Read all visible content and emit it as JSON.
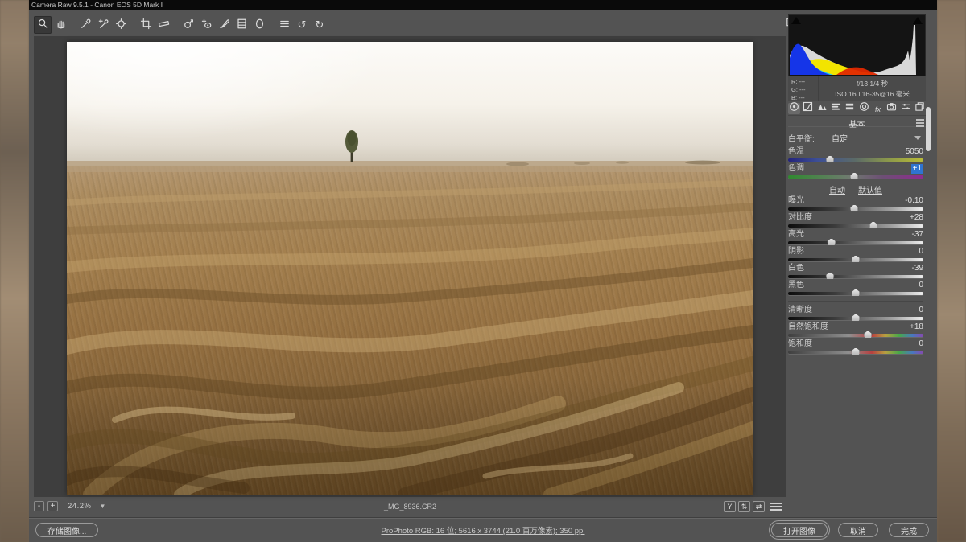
{
  "window": {
    "title": "Camera Raw 9.5.1 -  Canon EOS 5D Mark Ⅱ"
  },
  "toolbar": {
    "tools": [
      {
        "name": "zoom-tool",
        "icon": "magnifier-icon",
        "selected": true,
        "gap": false
      },
      {
        "name": "hand-tool",
        "icon": "hand-icon",
        "selected": false,
        "gap": false
      },
      {
        "name": "white-balance-tool",
        "icon": "eyedropper-icon",
        "selected": false,
        "gap": true
      },
      {
        "name": "color-sampler-tool",
        "icon": "eyedropper-plus-icon",
        "selected": false,
        "gap": false
      },
      {
        "name": "targeted-adjustment-tool",
        "icon": "target-icon",
        "selected": false,
        "gap": false
      },
      {
        "name": "crop-tool",
        "icon": "crop-icon",
        "selected": false,
        "gap": true
      },
      {
        "name": "straighten-tool",
        "icon": "straighten-icon",
        "selected": false,
        "gap": false
      },
      {
        "name": "spot-removal-tool",
        "icon": "heal-brush-icon",
        "selected": false,
        "gap": true
      },
      {
        "name": "red-eye-tool",
        "icon": "red-eye-icon",
        "selected": false,
        "gap": false
      },
      {
        "name": "adjustment-brush-tool",
        "icon": "brush-icon",
        "selected": false,
        "gap": false
      },
      {
        "name": "graduated-filter-tool",
        "icon": "graduated-filter-icon",
        "selected": false,
        "gap": false
      },
      {
        "name": "radial-filter-tool",
        "icon": "radial-filter-icon",
        "selected": false,
        "gap": false
      },
      {
        "name": "preferences-button",
        "icon": "menu-lines-icon",
        "selected": false,
        "gap": true
      },
      {
        "name": "rotate-left-button",
        "icon": "rotate-left-icon",
        "selected": false,
        "gap": false
      },
      {
        "name": "rotate-right-button",
        "icon": "rotate-right-icon",
        "selected": false,
        "gap": false
      }
    ]
  },
  "exif": {
    "r": "R: ---",
    "g": "G: ---",
    "b": "B: ---",
    "line1": "f/13  1/4 秒",
    "line2": "ISO 160  16-35@16 毫米"
  },
  "panel": {
    "tabs": [
      {
        "name": "tab-basic",
        "icon": "aperture-icon",
        "selected": true
      },
      {
        "name": "tab-tone-curve",
        "icon": "curve-icon",
        "selected": false
      },
      {
        "name": "tab-detail",
        "icon": "detail-icon",
        "selected": false
      },
      {
        "name": "tab-hsl-grayscale",
        "icon": "hsl-icon",
        "selected": false
      },
      {
        "name": "tab-split-toning",
        "icon": "split-toning-icon",
        "selected": false
      },
      {
        "name": "tab-lens-corrections",
        "icon": "lens-icon",
        "selected": false
      },
      {
        "name": "tab-effects",
        "icon": "fx-icon",
        "selected": false
      },
      {
        "name": "tab-camera-calibration",
        "icon": "camera-icon",
        "selected": false
      },
      {
        "name": "tab-presets",
        "icon": "presets-icon",
        "selected": false
      },
      {
        "name": "tab-snapshots",
        "icon": "snapshots-icon",
        "selected": false
      }
    ],
    "title": "基本"
  },
  "controls": {
    "white_balance_label": "白平衡:",
    "white_balance_value": "自定",
    "wb_sliders": [
      {
        "id": "temperature",
        "label": "色温",
        "value": "5050",
        "pos": 31,
        "track": "temp",
        "highlight": false
      },
      {
        "id": "tint",
        "label": "色调",
        "value": "+1",
        "pos": 49,
        "track": "tint",
        "highlight": true
      }
    ],
    "auto_label": "自动",
    "default_label": "默认值",
    "tone_sliders": [
      {
        "id": "exposure",
        "label": "曝光",
        "value": "-0.10",
        "pos": 49,
        "track": "tone",
        "highlight": false
      },
      {
        "id": "contrast",
        "label": "对比度",
        "value": "+28",
        "pos": 63,
        "track": "tone",
        "highlight": false
      },
      {
        "id": "highlights",
        "label": "高光",
        "value": "-37",
        "pos": 32,
        "track": "tone",
        "highlight": false
      },
      {
        "id": "shadows",
        "label": "阴影",
        "value": "0",
        "pos": 50,
        "track": "tone",
        "highlight": false
      },
      {
        "id": "whites",
        "label": "白色",
        "value": "-39",
        "pos": 31,
        "track": "tone",
        "highlight": false
      },
      {
        "id": "blacks",
        "label": "黑色",
        "value": "0",
        "pos": 50,
        "track": "tone",
        "highlight": false
      }
    ],
    "presence_sliders": [
      {
        "id": "clarity",
        "label": "清晰度",
        "value": "0",
        "pos": 50,
        "track": "tone",
        "highlight": false
      },
      {
        "id": "vibrance",
        "label": "自然饱和度",
        "value": "+18",
        "pos": 59,
        "track": "sat",
        "highlight": false
      },
      {
        "id": "saturation",
        "label": "饱和度",
        "value": "0",
        "pos": 50,
        "track": "sat",
        "highlight": false
      }
    ]
  },
  "statusbar": {
    "minus_label": "-",
    "plus_label": "+",
    "zoom_level": "24.2%",
    "filename": "_MG_8936.CR2",
    "preview_toggle_label": "Y",
    "swap_icon_glyph": "⇅",
    "copy_icon_glyph": "⇄"
  },
  "bottombar": {
    "save_label": "存储图像...",
    "workflow_text": "ProPhoto RGB: 16 位; 5616 x 3744 (21.0 百万像素); 350 ppi",
    "open_label": "打开图像",
    "cancel_label": "取消",
    "done_label": "完成"
  }
}
